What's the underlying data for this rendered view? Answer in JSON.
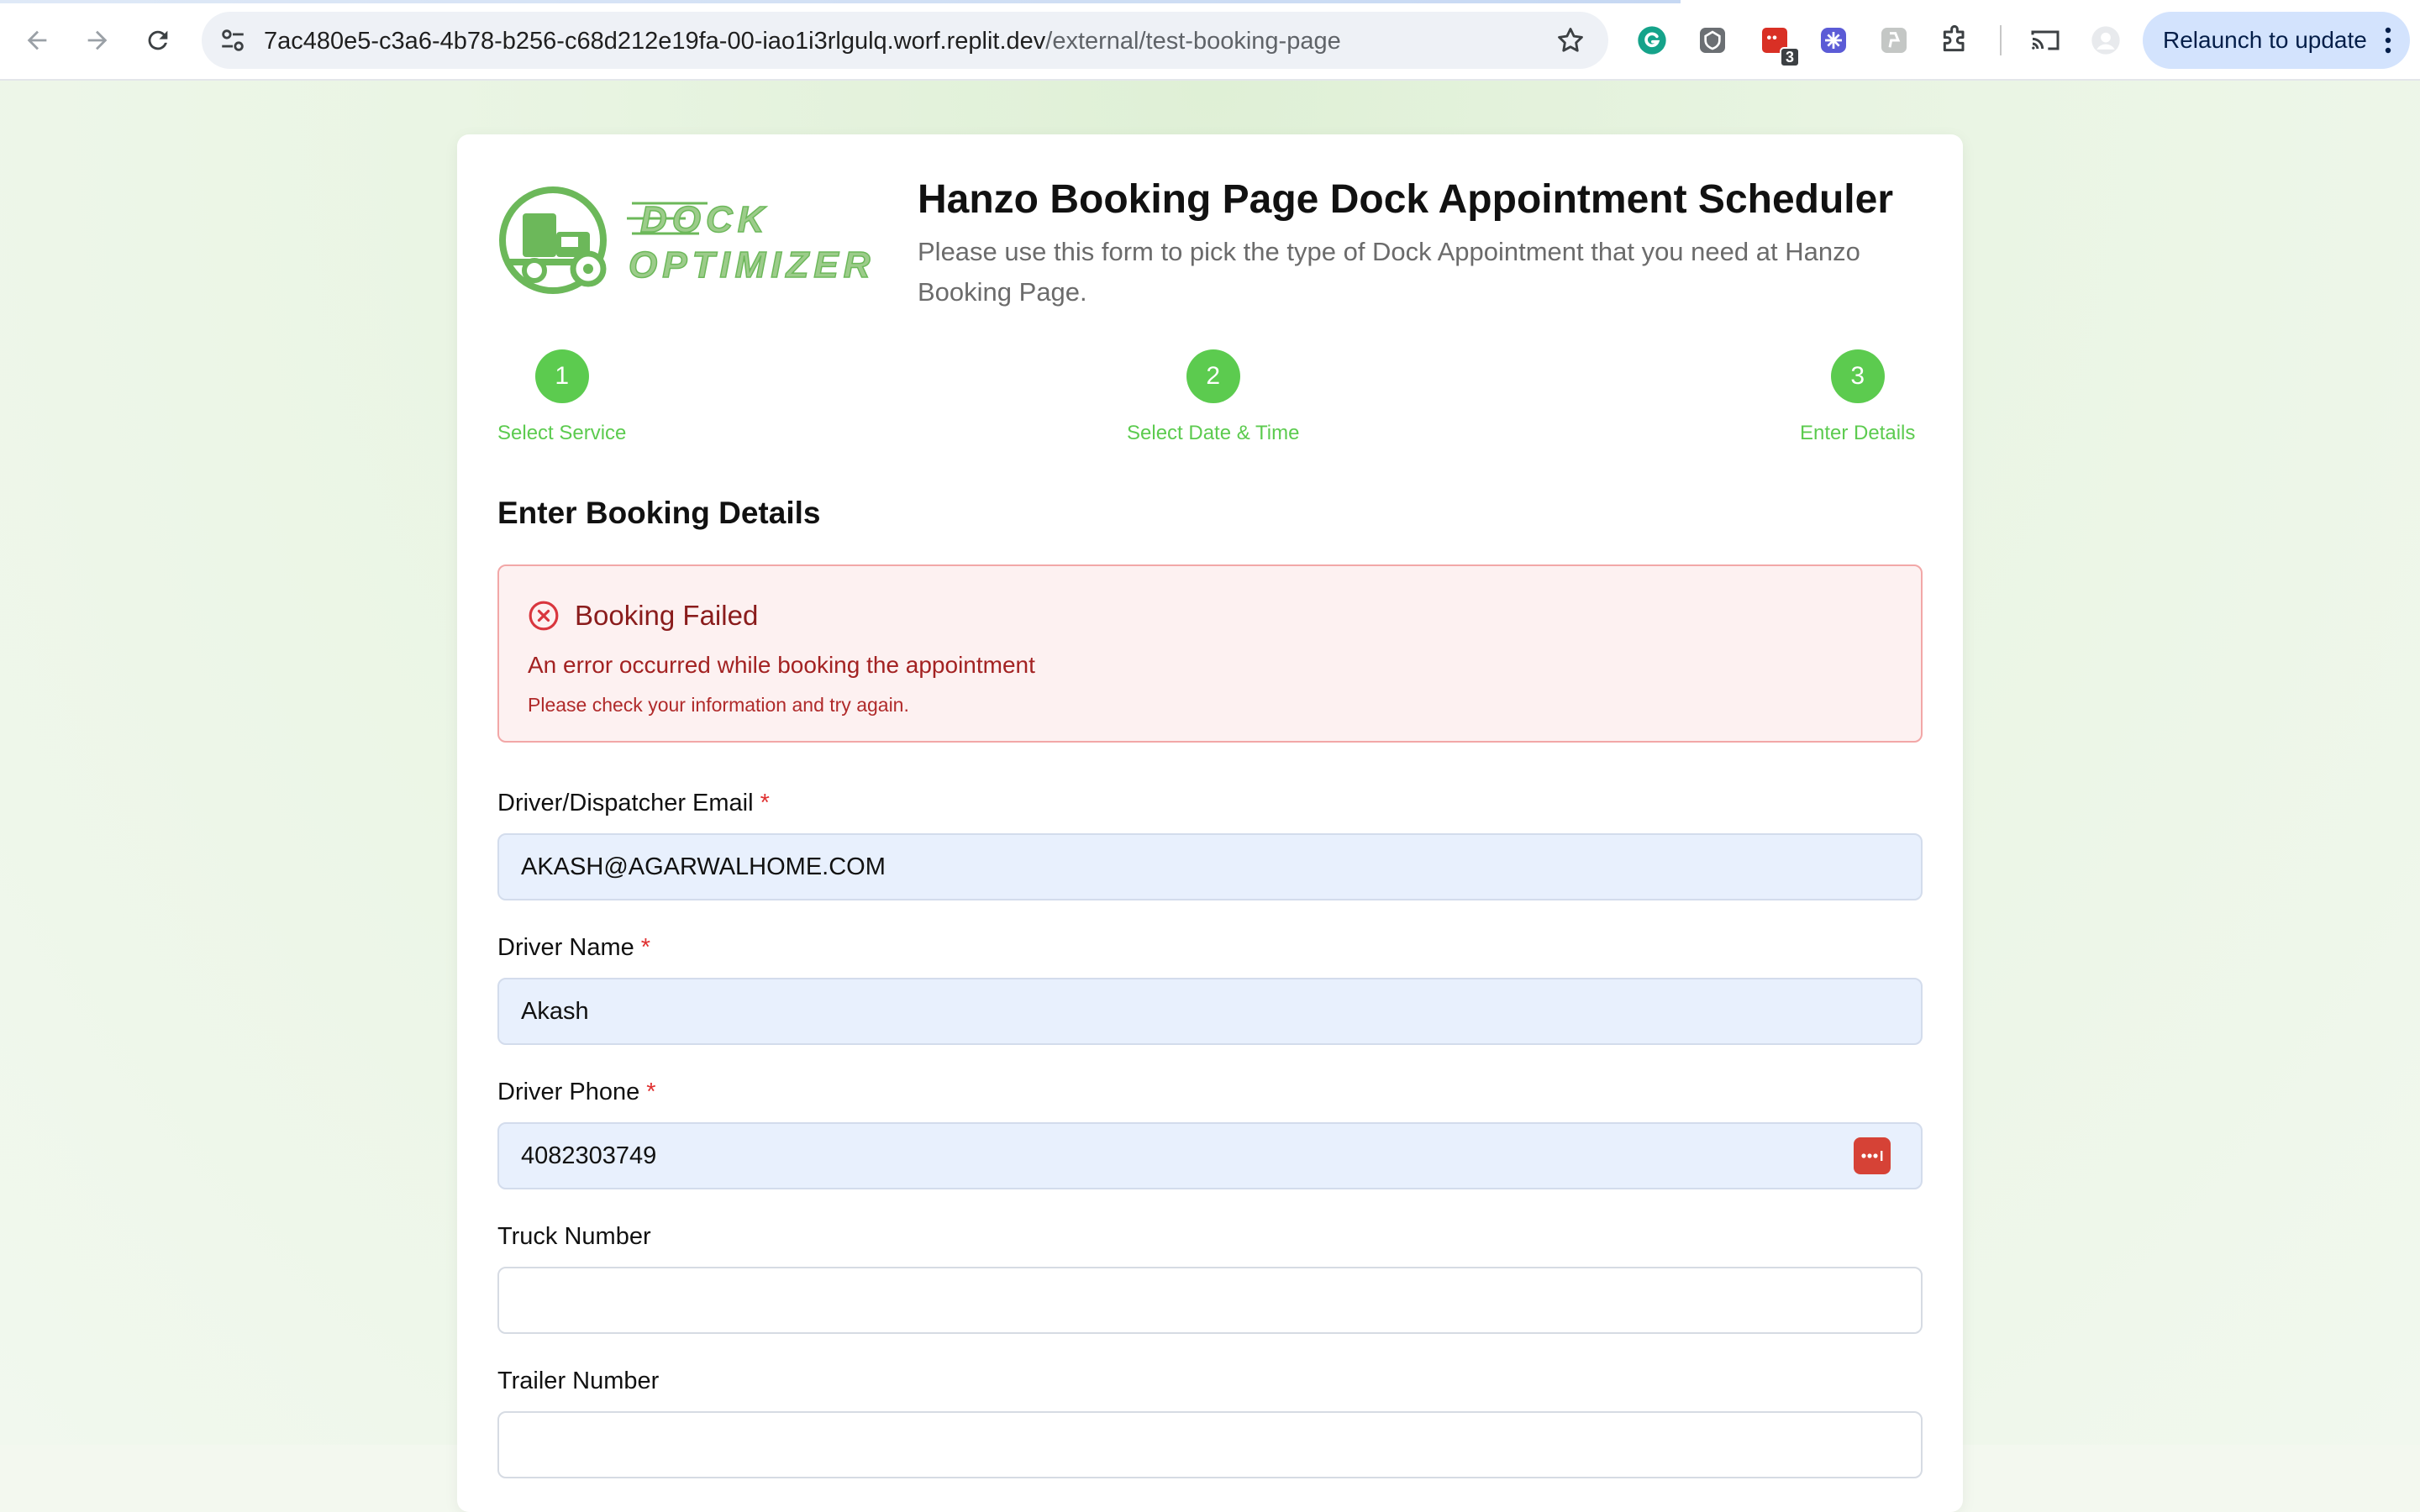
{
  "browser": {
    "url_host": "7ac480e5-c3a6-4b78-b256-c68d212e19fa-00-iao1i3rlgulq.worf.replit.dev",
    "url_path": "/external/test-booking-page",
    "relaunch_label": "Relaunch to update",
    "extension_badge_count": "3",
    "icons": [
      "back-arrow",
      "forward-arrow",
      "reload",
      "site-info",
      "bookmark-star",
      "grammarly",
      "extension-a",
      "extension-b",
      "extension-c",
      "extension-d",
      "extensions-puzzle",
      "cast",
      "profile",
      "more-vert"
    ]
  },
  "header": {
    "logo_line1": "DOCK",
    "logo_line2": "OPTIMIZER",
    "title": "Hanzo Booking Page Dock Appointment Scheduler",
    "description": "Please use this form to pick the type of Dock Appointment that you need at Hanzo Booking Page."
  },
  "steps": [
    {
      "number": "1",
      "label": "Select Service"
    },
    {
      "number": "2",
      "label": "Select Date & Time"
    },
    {
      "number": "3",
      "label": "Enter Details"
    }
  ],
  "section_title": "Enter Booking Details",
  "alert": {
    "title": "Booking Failed",
    "message": "An error occurred while booking the appointment",
    "hint": "Please check your information and try again."
  },
  "form": {
    "email": {
      "label": "Driver/Dispatcher Email",
      "required": "*",
      "value": "AKASH@AGARWALHOME.COM"
    },
    "name": {
      "label": "Driver Name",
      "required": "*",
      "value": "Akash"
    },
    "phone": {
      "label": "Driver Phone",
      "required": "*",
      "value": "4082303749"
    },
    "truck": {
      "label": "Truck Number",
      "value": ""
    },
    "trailer": {
      "label": "Trailer Number",
      "value": ""
    }
  },
  "colors": {
    "brand_green": "#5ccb4f",
    "error_text": "#8a1c1c",
    "error_bg": "#fdf1f1",
    "error_border": "#f2a7a7",
    "filled_input_bg": "#e8f0fd",
    "required_star": "#e03131"
  }
}
